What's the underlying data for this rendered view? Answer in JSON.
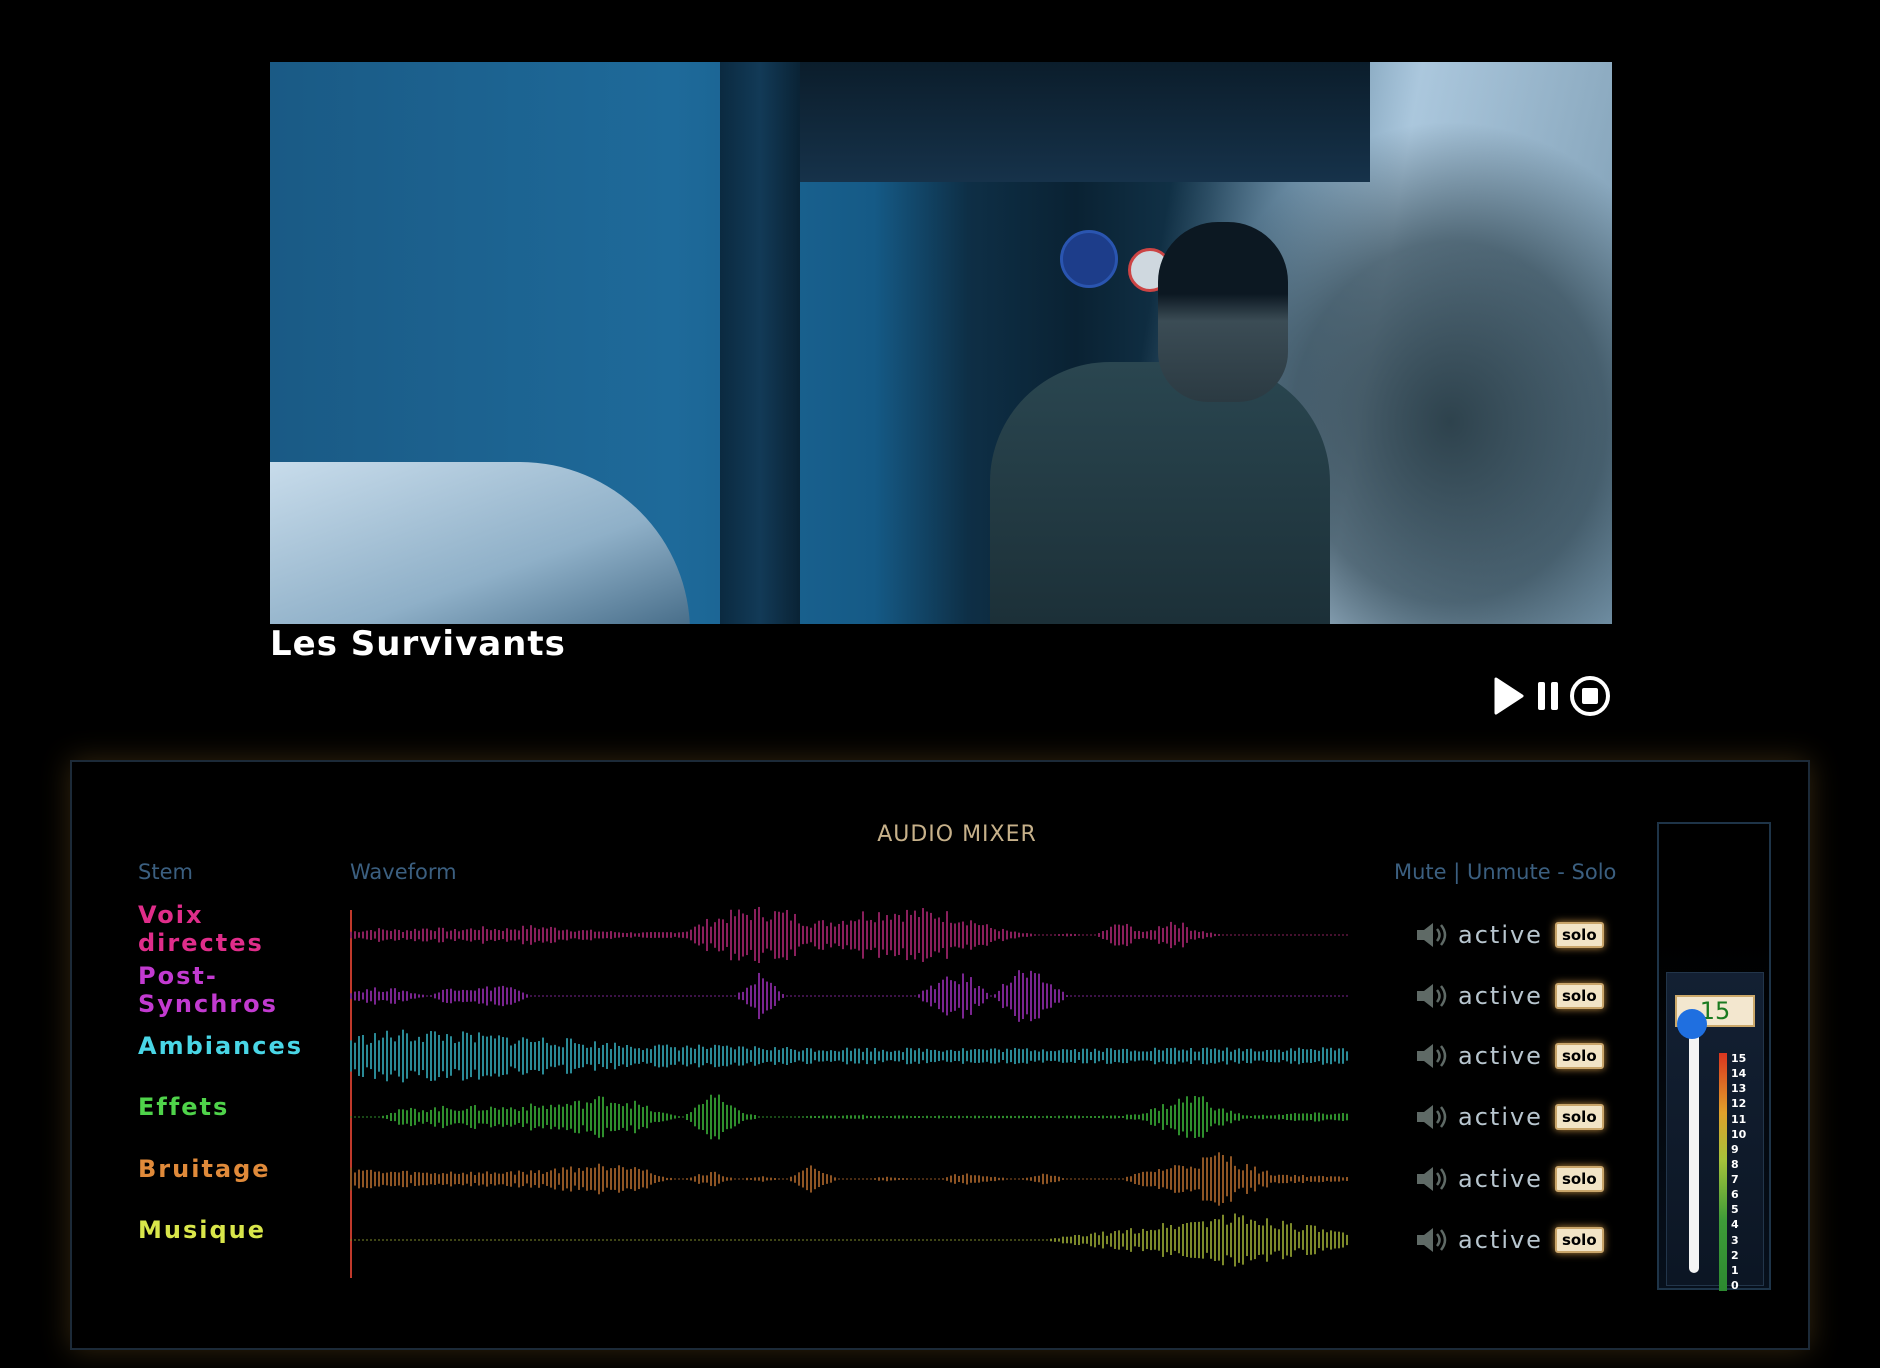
{
  "movie": {
    "title": "Les Survivants"
  },
  "transport": {
    "play_icon": "play-icon",
    "pause_icon": "pause-icon",
    "stop_icon": "stop-circle-icon"
  },
  "mixer": {
    "title": "AUDIO MIXER",
    "columns": {
      "stem": "Stem",
      "waveform": "Waveform",
      "controls": "Mute | Unmute - Solo"
    },
    "stems": [
      {
        "name": "Voix directes",
        "color": "#e02d8a",
        "wave_color": "#8a1f5c",
        "state": "active",
        "solo": "solo",
        "envelope": [
          0.15,
          0.25,
          0.2,
          0.3,
          0.2,
          0.3,
          0.25,
          0.35,
          0.3,
          0.2,
          0.15,
          0.1,
          0.1,
          0.15,
          0.6,
          0.9,
          1.0,
          0.9,
          0.5,
          0.6,
          0.9,
          1.0,
          0.95,
          0.9,
          0.7,
          0.3,
          0.1,
          0.0,
          0.05,
          0.0,
          0.5,
          0.1,
          0.6,
          0.2,
          0.0,
          0.0,
          0.0,
          0.0,
          0.0,
          0.0
        ]
      },
      {
        "name": "Post-Synchros",
        "color": "#c23ad0",
        "wave_color": "#7a2590",
        "state": "active",
        "solo": "solo",
        "envelope": [
          0.2,
          0.3,
          0.25,
          0.0,
          0.4,
          0.3,
          0.45,
          0.0,
          0.0,
          0.0,
          0.0,
          0.0,
          0.0,
          0.0,
          0.0,
          0.0,
          0.9,
          0.0,
          0.0,
          0.0,
          0.0,
          0.0,
          0.0,
          0.6,
          0.8,
          0.0,
          1.0,
          0.7,
          0.0,
          0.0,
          0.0,
          0.0,
          0.0,
          0.0,
          0.0,
          0.0,
          0.0,
          0.0,
          0.0,
          0.0
        ]
      },
      {
        "name": "Ambiances",
        "color": "#49d6e6",
        "wave_color": "#2a8a96",
        "state": "active",
        "solo": "solo",
        "envelope": [
          0.7,
          0.85,
          0.9,
          0.95,
          0.85,
          0.8,
          0.75,
          0.7,
          0.65,
          0.55,
          0.5,
          0.45,
          0.4,
          0.4,
          0.38,
          0.35,
          0.35,
          0.32,
          0.3,
          0.3,
          0.3,
          0.28,
          0.28,
          0.3,
          0.3,
          0.28,
          0.28,
          0.3,
          0.3,
          0.28,
          0.28,
          0.3,
          0.3,
          0.28,
          0.3,
          0.3,
          0.28,
          0.3,
          0.3,
          0.3
        ]
      },
      {
        "name": "Effets",
        "color": "#4fd34a",
        "wave_color": "#2f8f2d",
        "state": "active",
        "solo": "solo",
        "envelope": [
          0.0,
          0.0,
          0.3,
          0.35,
          0.4,
          0.4,
          0.4,
          0.45,
          0.5,
          0.6,
          0.8,
          0.6,
          0.2,
          0.0,
          1.0,
          0.3,
          0.0,
          0.0,
          0.05,
          0.05,
          0.08,
          0.05,
          0.05,
          0.05,
          0.05,
          0.05,
          0.05,
          0.05,
          0.05,
          0.05,
          0.05,
          0.2,
          0.6,
          0.9,
          0.3,
          0.05,
          0.1,
          0.15,
          0.15,
          0.15
        ]
      },
      {
        "name": "Bruitage",
        "color": "#e08a3a",
        "wave_color": "#8f5524",
        "state": "active",
        "solo": "solo",
        "envelope": [
          0.5,
          0.3,
          0.3,
          0.25,
          0.3,
          0.25,
          0.3,
          0.3,
          0.4,
          0.5,
          0.6,
          0.7,
          0.1,
          0.0,
          0.3,
          0.0,
          0.1,
          0.0,
          0.5,
          0.0,
          0.0,
          0.1,
          0.0,
          0.0,
          0.3,
          0.1,
          0.0,
          0.2,
          0.0,
          0.0,
          0.0,
          0.3,
          0.5,
          0.7,
          1.0,
          0.5,
          0.2,
          0.15,
          0.1,
          0.1
        ]
      },
      {
        "name": "Musique",
        "color": "#d9e64a",
        "wave_color": "#7d8a2a",
        "state": "active",
        "solo": "solo",
        "envelope": [
          0.0,
          0.0,
          0.0,
          0.0,
          0.0,
          0.0,
          0.0,
          0.0,
          0.0,
          0.0,
          0.0,
          0.0,
          0.0,
          0.0,
          0.0,
          0.0,
          0.0,
          0.0,
          0.0,
          0.0,
          0.0,
          0.0,
          0.0,
          0.0,
          0.0,
          0.0,
          0.0,
          0.0,
          0.15,
          0.25,
          0.35,
          0.5,
          0.65,
          0.8,
          0.95,
          0.9,
          0.8,
          0.6,
          0.4,
          0.2
        ]
      }
    ],
    "speaker_icon": "speaker-icon",
    "master": {
      "value": "15",
      "level": 15,
      "max": 15,
      "scale": [
        "15",
        "14",
        "13",
        "12",
        "11",
        "10",
        "9",
        "8",
        "7",
        "6",
        "5",
        "4",
        "3",
        "2",
        "1",
        "0"
      ]
    }
  }
}
